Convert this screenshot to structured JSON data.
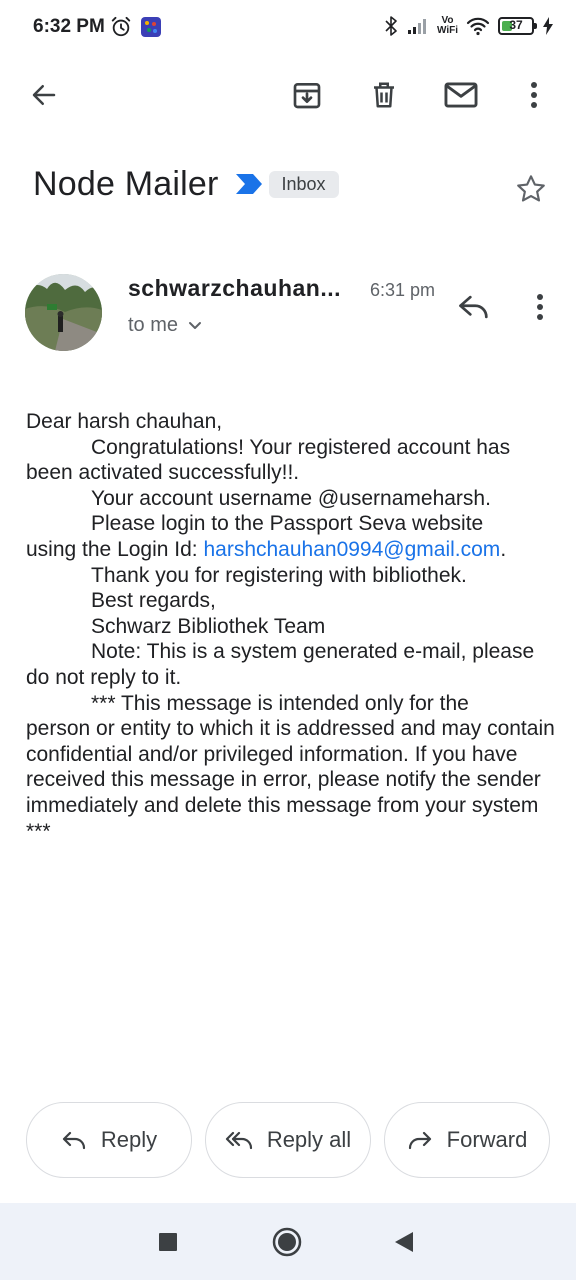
{
  "status_bar": {
    "time": "6:32 PM",
    "battery_level": "37",
    "network_label_top": "Vo",
    "network_label_bottom": "WiFi"
  },
  "app_bar": {
    "icons": [
      "back-arrow-icon",
      "archive-icon",
      "delete-icon",
      "mark-unread-icon",
      "more-vert-icon"
    ]
  },
  "email": {
    "subject": "Node Mailer",
    "label": "Inbox",
    "sender": "schwarzchauhan...",
    "time": "6:31 pm",
    "recipient": "to me",
    "body": {
      "greeting": "Dear  harsh chauhan,",
      "line1": "Congratulations! Your registered account has",
      "line1_cont": "been activated successfully!!.",
      "line2": "Your account username @usernameharsh.",
      "line3": "Please login to the Passport Seva website",
      "line3_prefix": "using the Login Id: ",
      "login_email": "harshchauhan0994@gmail.com",
      "line3_suffix": ".",
      "line4": "Thank you for registering with bibliothek.",
      "line5": "Best regards,",
      "line6": "Schwarz Bibliothek Team",
      "line7": "Note: This is a system generated e-mail, please",
      "line7_cont": "do not reply to it.",
      "disclaimer_first": "*** This message is intended only for the",
      "disclaimer_rest": "person or entity to which it is addressed and may contain confidential and/or privileged information. If you have received this message in error, please notify the sender immediately and delete this message from your system ***"
    }
  },
  "actions": {
    "reply": "Reply",
    "reply_all": "Reply all",
    "forward": "Forward"
  },
  "colors": {
    "link": "#1a73e8",
    "importance_marker": "#1a73e8",
    "nav_bar_bg": "#eef2f9"
  }
}
